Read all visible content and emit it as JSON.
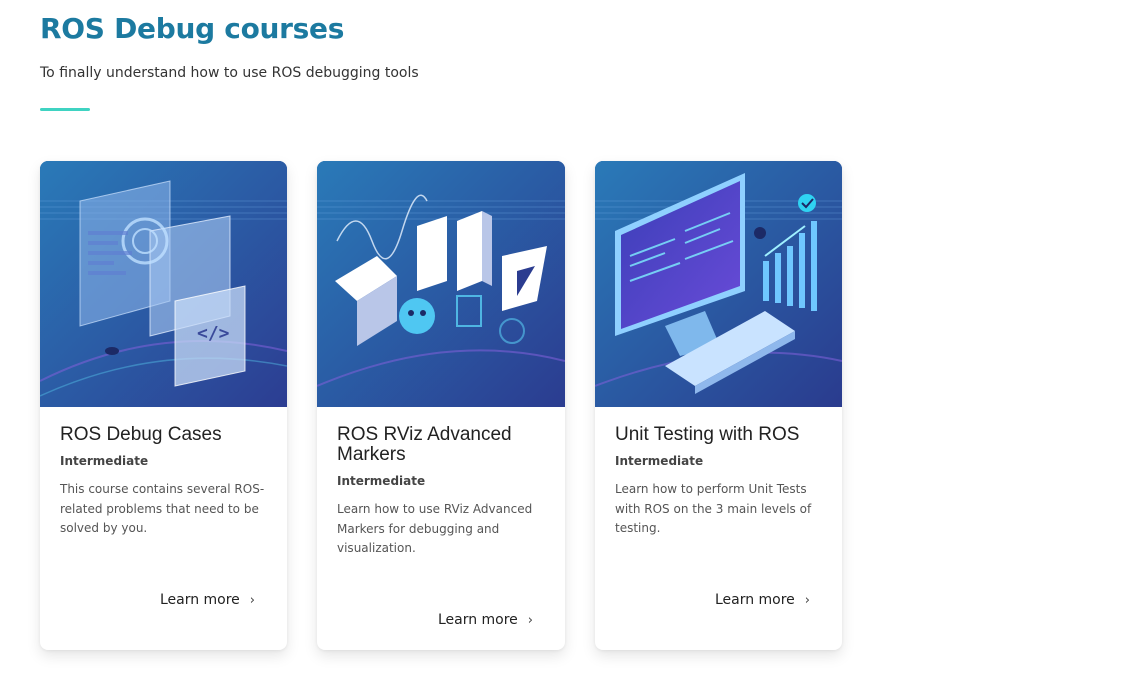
{
  "header": {
    "title": "ROS Debug courses",
    "subtitle": "To finally understand how to use ROS debugging tools"
  },
  "colors": {
    "title": "#1c7aa0",
    "accent_line": "#3fd3c2",
    "card_image_bg": "#264ea0"
  },
  "courses": [
    {
      "title": "ROS Debug Cases",
      "level": "Intermediate",
      "description": "This course contains several ROS-related problems that need to be solved by you.",
      "cta": "Learn more",
      "image_icon": "debug-windows-illustration"
    },
    {
      "title": "ROS RViz Advanced Markers",
      "level": "Intermediate",
      "description": "Learn how to use RViz Advanced Markers for debugging and visualization.",
      "cta": "Learn more",
      "image_icon": "rviz-letters-illustration"
    },
    {
      "title": "Unit Testing with ROS",
      "level": "Intermediate",
      "description": "Learn how to perform Unit Tests with ROS on the 3 main levels of testing.",
      "cta": "Learn more",
      "image_icon": "monitor-keyboard-illustration"
    }
  ]
}
